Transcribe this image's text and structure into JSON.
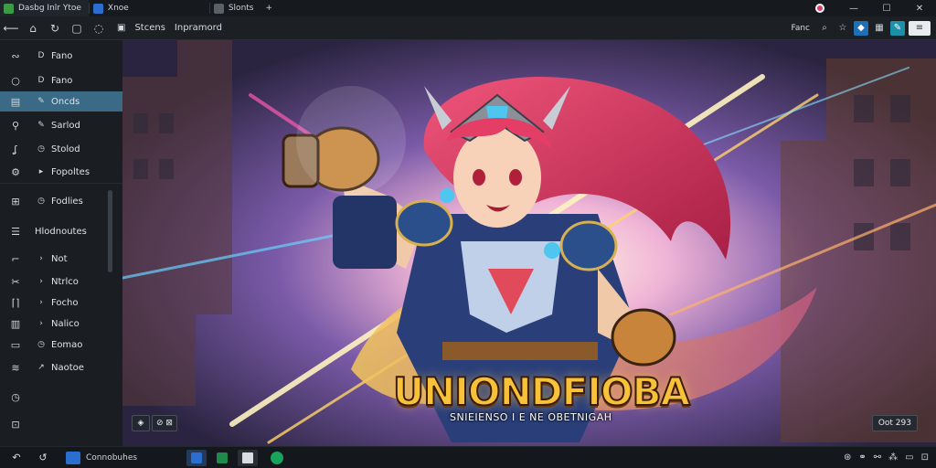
{
  "tabbar": {
    "tabs": [
      {
        "label": "Dasbg Inlr Ytoe",
        "icon": "app-green-icon"
      },
      {
        "label": "Xnoe",
        "icon": "window-blue-icon"
      },
      {
        "label": "Slonts",
        "icon": "doc-gray-icon"
      }
    ],
    "new_tab": "+",
    "profile_icon": "profile-icon"
  },
  "toolbar": {
    "breadcrumb_1": "Stcens",
    "breadcrumb_2": "Inpramord",
    "right_label": "Fanc"
  },
  "sidebar": {
    "items": [
      {
        "label": "Fano",
        "icon": "loop-icon",
        "row_icon": "chevron-icon"
      },
      {
        "label": "Fano",
        "icon": "circle-icon",
        "row_icon": "chevron-icon"
      },
      {
        "label": "Oncds",
        "icon": "box-icon",
        "row_icon": "pen-icon",
        "active": true
      },
      {
        "label": "Sarlod",
        "icon": "pin-icon",
        "row_icon": "pen-icon"
      },
      {
        "label": "Stolod",
        "icon": "scribble-icon",
        "row_icon": "clock-icon"
      },
      {
        "label": "Fopoltes",
        "icon": "gear-icon",
        "row_icon": "chevron-icon"
      },
      {
        "label": "Fodlies",
        "icon": "grid-icon",
        "row_icon": "clock-icon"
      },
      {
        "label": "Hlodnoutes",
        "icon": "list-icon",
        "row_icon": ""
      },
      {
        "label": "Not",
        "icon": "corner-icon",
        "row_icon": "chevron-icon"
      },
      {
        "label": "Ntrlco",
        "icon": "scissors-icon",
        "row_icon": "chevron-icon"
      },
      {
        "label": "Focho",
        "icon": "frame-icon",
        "row_icon": "chevron-icon"
      },
      {
        "label": "Nalico",
        "icon": "table-icon",
        "row_icon": "chevron-icon"
      },
      {
        "label": "Eomao",
        "icon": "monitor-icon",
        "row_icon": "clock-icon"
      },
      {
        "label": "Naotoe",
        "icon": "layers-icon",
        "row_icon": "chevron-icon"
      },
      {
        "label": "",
        "icon": "clock-icon",
        "row_icon": ""
      },
      {
        "label": "",
        "icon": "square-icon",
        "row_icon": ""
      }
    ]
  },
  "main": {
    "logo_text": "UNIONDFIOBA",
    "tagline": "SNIEIENSO I E NE OBETNIGAH",
    "controls": [
      "◈",
      "⊘ ⊠"
    ],
    "right_control": "Oot 293"
  },
  "taskbar": {
    "app_label": "Connobuhes",
    "apps": [
      {
        "icon": "browser-icon",
        "color": "#2a6fcf"
      },
      {
        "icon": "sheet-icon",
        "color": "#1f8a4c"
      },
      {
        "icon": "window-icon",
        "color": "#d9dde2"
      },
      {
        "icon": "chat-icon",
        "color": "#17a35a"
      }
    ]
  },
  "colors": {
    "accent": "#3a6a86",
    "logo_gold": "#f7c23a",
    "hair": "#d8345a"
  }
}
